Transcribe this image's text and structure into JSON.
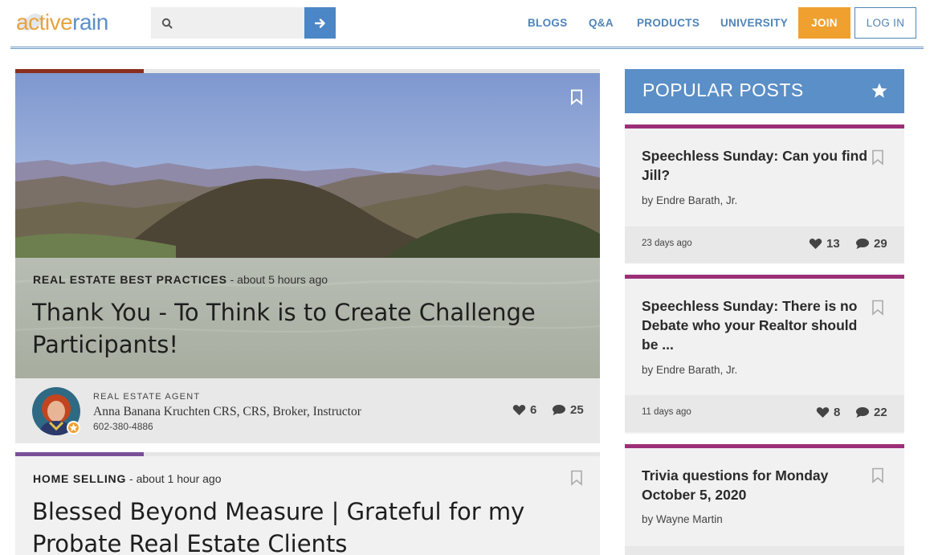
{
  "header": {
    "logo": {
      "part1": "active",
      "part2": "rain"
    },
    "search": {
      "placeholder": ""
    },
    "nav": [
      {
        "label": "BLOGS"
      },
      {
        "label": "Q&A"
      },
      {
        "label": "PRODUCTS"
      },
      {
        "label": "UNIVERSITY"
      }
    ],
    "join_label": "JOIN",
    "login_label": "LOG IN"
  },
  "feature_post": {
    "category": "REAL ESTATE BEST PRACTICES",
    "time": " - about 5 hours ago",
    "title_line1": "Thank You - To Think is to Create Challenge",
    "title_line2": "Participants!",
    "author": {
      "role": "REAL ESTATE AGENT",
      "name": "Anna Banana Kruchten CRS, CRS, Broker, Instructor",
      "phone": "602-380-4886"
    },
    "likes": "6",
    "comments": "25"
  },
  "second_post": {
    "category": "HOME SELLING",
    "time": " - about 1 hour ago",
    "title_line1": "Blessed Beyond Measure | Grateful for my",
    "title_line2": "Probate Real Estate Clients"
  },
  "popular": {
    "title": "POPULAR POSTS",
    "posts": [
      {
        "title": "Speechless Sunday: Can you find Jill?",
        "by": "by Endre Barath, Jr.",
        "age": "23 days ago",
        "likes": "13",
        "comments": "29"
      },
      {
        "title": "Speechless Sunday: There is no Debate who your Realtor should be ...",
        "by": "by Endre Barath, Jr.",
        "age": "11 days ago",
        "likes": "8",
        "comments": "22"
      },
      {
        "title": "Trivia questions for Monday October 5, 2020",
        "by": "by Wayne Martin"
      }
    ]
  },
  "colors": {
    "brand_blue": "#5b8fc7",
    "brand_orange": "#f0a02f",
    "popular_accent": "#9c2f77"
  },
  "icons": [
    "search-icon",
    "arrow-right-icon",
    "bookmark-icon",
    "heart-icon",
    "comment-icon",
    "star-icon"
  ]
}
